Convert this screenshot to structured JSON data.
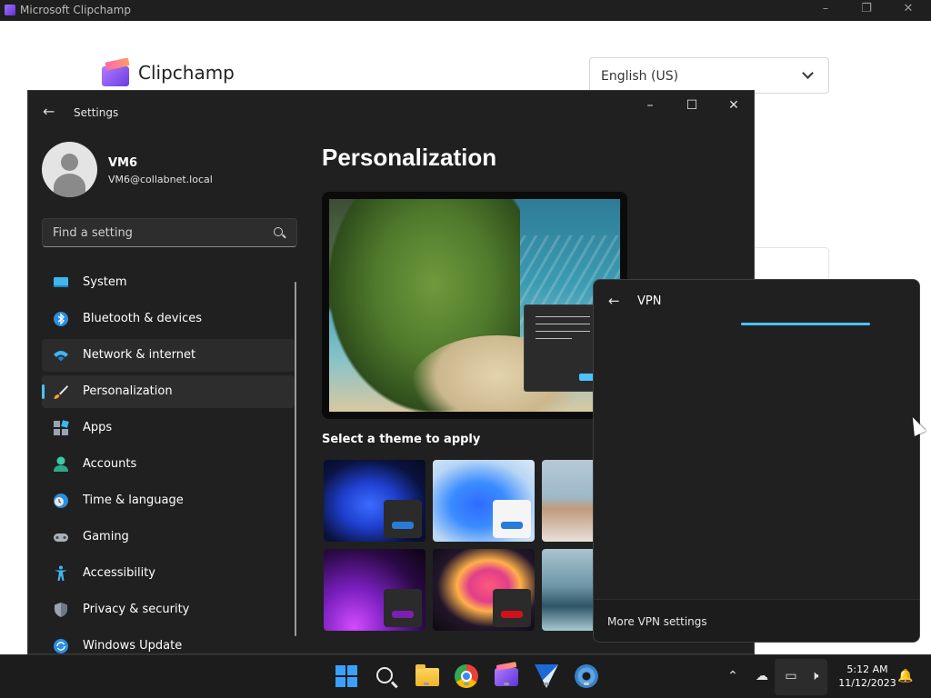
{
  "clipchamp": {
    "window_title": "Microsoft Clipchamp",
    "brand": "Clipchamp",
    "language": "English (US)"
  },
  "settings": {
    "title": "Settings",
    "user": {
      "name": "VM6",
      "email": "VM6@collabnet.local"
    },
    "search_placeholder": "Find a setting",
    "nav": [
      {
        "label": "System",
        "icon": "system-icon"
      },
      {
        "label": "Bluetooth & devices",
        "icon": "bluetooth-icon"
      },
      {
        "label": "Network & internet",
        "icon": "wifi-icon",
        "state": "hover"
      },
      {
        "label": "Personalization",
        "icon": "brush-icon",
        "state": "active"
      },
      {
        "label": "Apps",
        "icon": "apps-icon"
      },
      {
        "label": "Accounts",
        "icon": "accounts-icon"
      },
      {
        "label": "Time & language",
        "icon": "clock-globe-icon"
      },
      {
        "label": "Gaming",
        "icon": "gamepad-icon"
      },
      {
        "label": "Accessibility",
        "icon": "accessibility-icon"
      },
      {
        "label": "Privacy & security",
        "icon": "shield-icon"
      },
      {
        "label": "Windows Update",
        "icon": "update-icon"
      }
    ],
    "page_title": "Personalization",
    "theme_label": "Select a theme to apply",
    "accent_color": "#4cc2ff"
  },
  "vpn": {
    "title": "VPN",
    "more_settings": "More VPN settings"
  },
  "taskbar": {
    "apps": [
      "start-icon",
      "search-icon",
      "file-explorer-icon",
      "chrome-icon",
      "clipchamp-icon",
      "kite-icon",
      "settings-gear-icon"
    ],
    "time": "5:12 AM",
    "date": "11/12/2023"
  }
}
